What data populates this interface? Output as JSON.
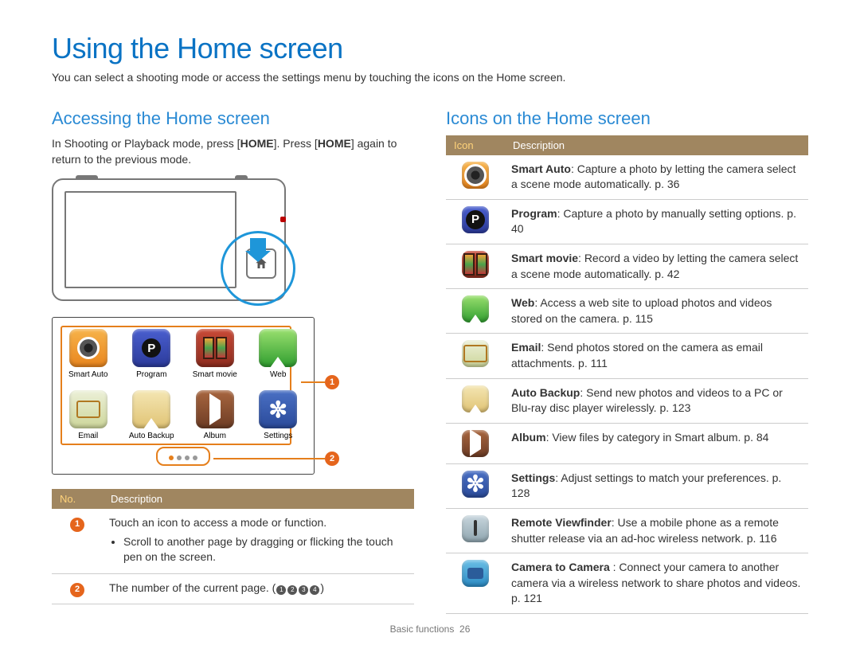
{
  "title": "Using the Home screen",
  "subtitle": "You can select a shooting mode or access the settings menu by touching the icons on the Home screen.",
  "left": {
    "heading": "Accessing the Home screen",
    "intro_parts": [
      "In Shooting or Playback mode, press [",
      "HOME",
      "]. Press [",
      "HOME",
      "] again to return to the previous mode."
    ],
    "launchers": [
      {
        "name": "Smart Auto",
        "cls": "ic-smart-auto",
        "glyph": "glyph-lens"
      },
      {
        "name": "Program",
        "cls": "ic-program",
        "glyph": "glyph-p"
      },
      {
        "name": "Smart movie",
        "cls": "ic-smart-movie",
        "glyph": "glyph-film"
      },
      {
        "name": "Web",
        "cls": "ic-web",
        "glyph": "glyph-arrow-up"
      },
      {
        "name": "Email",
        "cls": "ic-email",
        "glyph": "glyph-mail"
      },
      {
        "name": "Auto Backup",
        "cls": "ic-auto-backup",
        "glyph": "glyph-arrow-up"
      },
      {
        "name": "Album",
        "cls": "ic-album",
        "glyph": "glyph-play"
      },
      {
        "name": "Settings",
        "cls": "ic-settings",
        "glyph": "glyph-gear"
      }
    ],
    "table_headers": [
      "No.",
      "Description"
    ],
    "rows": [
      {
        "n": "1",
        "text": "Touch an icon to access a mode or function.",
        "bullets": [
          "Scroll to another page by dragging or flicking the touch pen on the screen."
        ]
      },
      {
        "n": "2",
        "text": "The number of the current page. ( ① ② ③ ④ )"
      }
    ]
  },
  "right": {
    "heading": "Icons on the Home screen",
    "table_headers": [
      "Icon",
      "Description"
    ],
    "rows": [
      {
        "cls": "ic-smart-auto",
        "glyph": "glyph-lens",
        "bold": "Smart Auto",
        "text": ": Capture a photo by letting the camera select a scene mode automatically. p. 36"
      },
      {
        "cls": "ic-program",
        "glyph": "glyph-p",
        "bold": "Program",
        "text": ": Capture a photo by manually setting options. p. 40"
      },
      {
        "cls": "ic-smart-movie",
        "glyph": "glyph-film",
        "bold": "Smart movie",
        "text": ": Record a video by letting the camera select a scene mode automatically. p. 42"
      },
      {
        "cls": "ic-web",
        "glyph": "glyph-arrow-up",
        "bold": "Web",
        "text": ": Access a web site to upload photos and videos stored on the camera. p. 115"
      },
      {
        "cls": "ic-email",
        "glyph": "glyph-mail",
        "bold": "Email",
        "text": ": Send photos stored on the camera as email attachments. p. 111"
      },
      {
        "cls": "ic-auto-backup",
        "glyph": "glyph-arrow-up",
        "bold": "Auto Backup",
        "text": ": Send new photos and videos to a PC or Blu-ray disc player wirelessly. p. 123"
      },
      {
        "cls": "ic-album",
        "glyph": "glyph-play",
        "bold": "Album",
        "text": ": View files by category in Smart album. p. 84"
      },
      {
        "cls": "ic-settings",
        "glyph": "glyph-gear",
        "bold": "Settings",
        "text": ": Adjust settings to match your preferences. p. 128"
      },
      {
        "cls": "ic-remote",
        "glyph": "glyph-phone",
        "bold": "Remote Viewfinder",
        "text": ": Use a mobile phone as a remote shutter release via an ad-hoc wireless network. p. 116"
      },
      {
        "cls": "ic-cam2cam",
        "glyph": "glyph-cam",
        "bold": "Camera to Camera ",
        "text": ": Connect your camera to another camera via a wireless network to share photos and videos. p. 121"
      }
    ]
  },
  "footer": {
    "section": "Basic functions",
    "page": "26"
  }
}
